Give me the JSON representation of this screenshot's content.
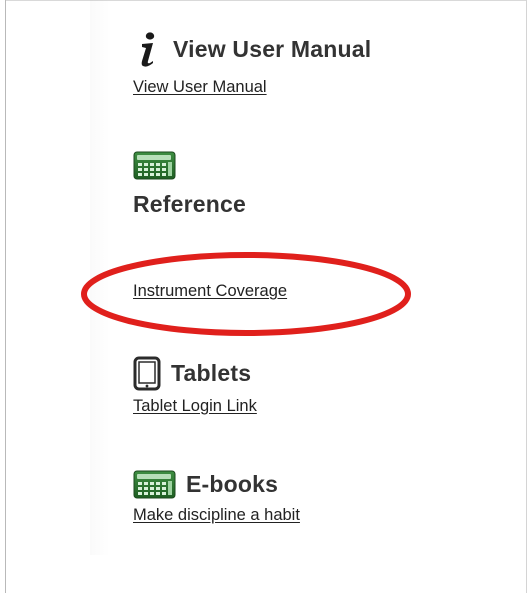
{
  "sections": {
    "manual": {
      "icon": "info-icon",
      "heading": "View User Manual",
      "link": "View User Manual"
    },
    "reference": {
      "icon": "calculator-icon",
      "heading": "Reference",
      "link": "Instrument Coverage"
    },
    "tablets": {
      "icon": "tablet-icon",
      "heading": "Tablets",
      "link": "Tablet Login Link"
    },
    "ebooks": {
      "icon": "calculator-icon",
      "heading": "E-books",
      "link": "Make discipline a habit"
    }
  },
  "colors": {
    "info_icon": "#1a1a1a",
    "info_dot": "#1a1a1a",
    "calculator_body": "#2e7d32",
    "calculator_screen": "#c8e6c9",
    "highlight_ellipse": "#e0201c",
    "link_text": "#222222",
    "heading_text": "#333333"
  }
}
